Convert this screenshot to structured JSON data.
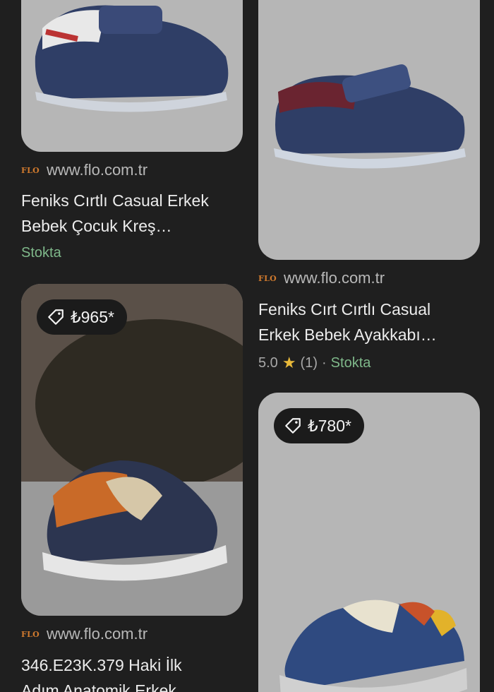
{
  "results": [
    {
      "source": {
        "logo": "FLO",
        "domain": "www.flo.com.tr"
      },
      "title_line1": "Feniks Cırtlı Casual Erkek",
      "title_line2": "Bebek Çocuk Kreş…",
      "stock": "Stokta",
      "image": "navy-white-loafer-shoe"
    },
    {
      "source": {
        "logo": "FLO",
        "domain": "www.flo.com.tr"
      },
      "title_line1": "Feniks Cırt Cırtlı Casual",
      "title_line2": "Erkek Bebek Ayakkabı…",
      "rating": "5.0",
      "review_count": "(1)",
      "separator": "·",
      "stock": "Stokta",
      "image": "navy-burgundy-loafer-shoe"
    },
    {
      "price": "₺965*",
      "source": {
        "logo": "FLO",
        "domain": "www.flo.com.tr"
      },
      "title_line1": "346.E23K.379 Haki İlk",
      "title_line2": "Adım Anatomik Erkek",
      "image": "orange-beige-sneaker"
    },
    {
      "price": "₺780*",
      "image": "blue-orange-sneaker"
    }
  ],
  "icons": {
    "price_tag": "tag-icon",
    "rating": "star-icon"
  }
}
